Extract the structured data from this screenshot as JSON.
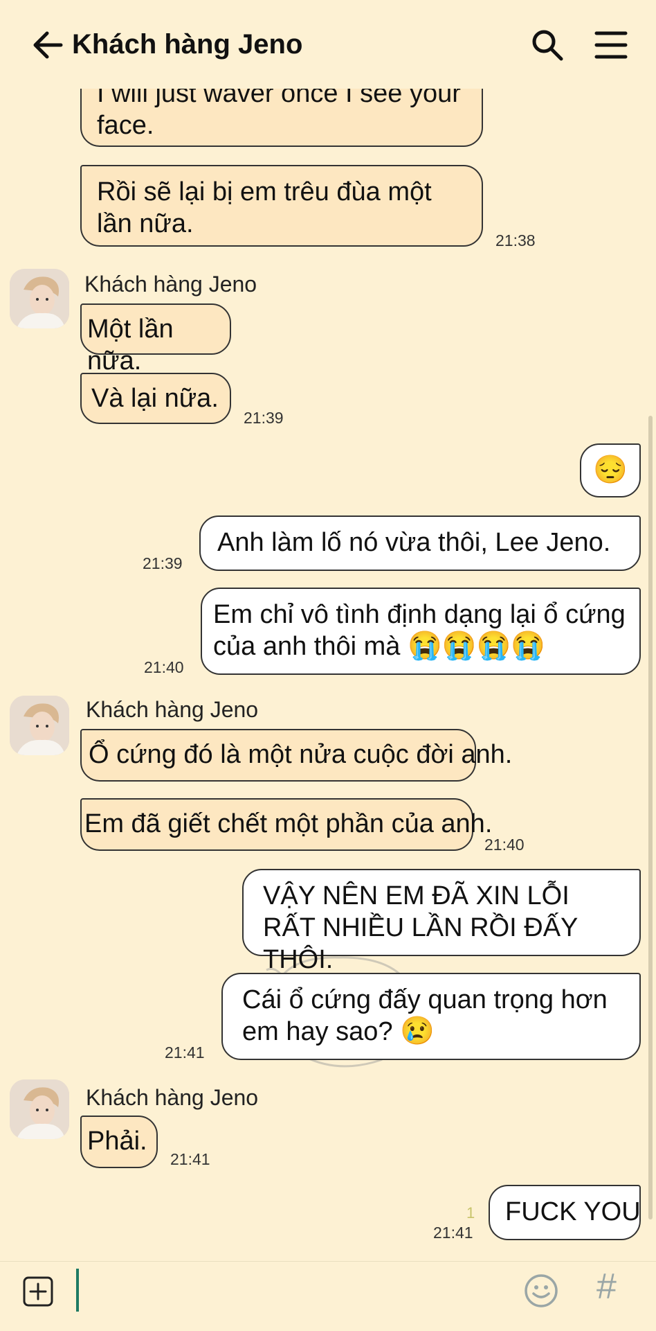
{
  "header": {
    "title": "Khách hàng Jeno"
  },
  "contact": {
    "name": "Khách hàng Jeno"
  },
  "messages": [
    {
      "text": "I will just waver once I see your face."
    },
    {
      "text": "Rồi sẽ lại bị em trêu đùa một lần nữa.",
      "time": "21:38"
    },
    {
      "text": "Một lần nữa."
    },
    {
      "text": "Và lại nữa.",
      "time": "21:39"
    },
    {
      "emoji": "😔"
    },
    {
      "text": "Anh làm lố nó vừa thôi, Lee Jeno.",
      "time": "21:39"
    },
    {
      "text": "Em chỉ vô tình định dạng lại ổ cứng của anh thôi mà ",
      "emoji": "😭😭😭😭",
      "time": "21:40"
    },
    {
      "text": "Ổ cứng đó là một nửa cuộc đời anh."
    },
    {
      "text": "Em đã giết chết một phần của anh.",
      "time": "21:40"
    },
    {
      "text": "VẬY NÊN EM ĐÃ XIN LỖI RẤT NHIỀU LẦN RỒI ĐẤY THÔI."
    },
    {
      "text": "Cái ổ cứng đấy quan trọng hơn em hay sao? ",
      "emoji": "😢",
      "time": "21:41"
    },
    {
      "text": "Phải.",
      "time": "21:41"
    },
    {
      "text": "FUCK YOU",
      "time": "21:41",
      "read": "1"
    }
  ],
  "colors": {
    "background": "#fdf1d3",
    "incoming": "#fde7c1",
    "outgoing": "#ffffff",
    "cursor": "#1f7a63"
  },
  "icons": {
    "back": "arrow-left-icon",
    "search": "search-icon",
    "menu": "hamburger-menu-icon",
    "add": "add-square-icon",
    "emoji": "smiley-icon",
    "hash": "hash-icon"
  }
}
